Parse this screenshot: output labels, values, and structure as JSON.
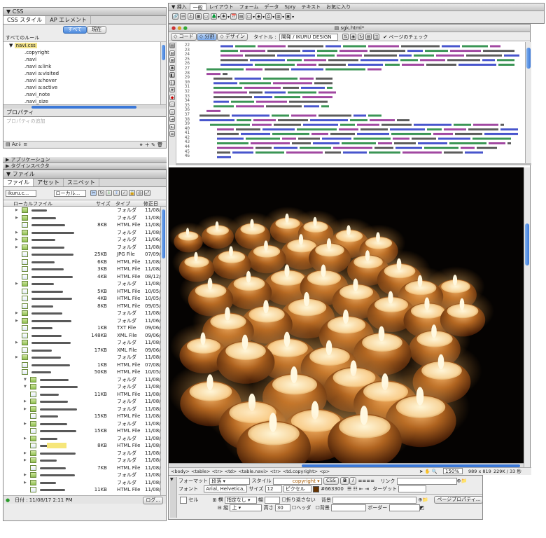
{
  "css_panel": {
    "title": "CSS",
    "tabs": [
      "CSS スタイル",
      "AP エレメント"
    ],
    "mode_buttons": [
      "すべて",
      "現在"
    ],
    "rules_header": "すべてのルール",
    "stylesheet": "navi.css",
    "rules": [
      ".copyright",
      ".navi",
      ".navi a:link",
      ".navi a:visited",
      ".navi a:hover",
      ".navi a:active",
      ".navi_note",
      ".navi_size"
    ],
    "properties_header": "プロパティ",
    "add_property": "プロパティの追加"
  },
  "collapsed_panels": [
    "アプリケーション",
    "タグインスペクタ"
  ],
  "files_panel": {
    "title": "ファイル",
    "tabs": [
      "ファイル",
      "アセット",
      "スニペット"
    ],
    "site": "ikuru.c...",
    "view": "ローカル...",
    "columns": [
      "ローカルファイル",
      "サイズ",
      "タイプ",
      "修正日"
    ],
    "rows": [
      {
        "size": "",
        "type": "フォルダ",
        "date": "11/08/16"
      },
      {
        "size": "",
        "type": "フォルダ",
        "date": "11/08/16"
      },
      {
        "size": "8KB",
        "type": "HTML File",
        "date": "11/08/16"
      },
      {
        "size": "",
        "type": "フォルダ",
        "date": "11/08/16"
      },
      {
        "size": "",
        "type": "フォルダ",
        "date": "11/06/08"
      },
      {
        "size": "",
        "type": "フォルダ",
        "date": "11/08/16"
      },
      {
        "size": "25KB",
        "type": "JPG File",
        "date": "07/09/12"
      },
      {
        "size": "6KB",
        "type": "HTML File",
        "date": "11/08/16"
      },
      {
        "size": "3KB",
        "type": "HTML File",
        "date": "11/08/17"
      },
      {
        "size": "4KB",
        "type": "HTML File",
        "date": "08/12/07"
      },
      {
        "size": "",
        "type": "フォルダ",
        "date": "11/08/17"
      },
      {
        "size": "5KB",
        "type": "HTML File",
        "date": "10/05/07"
      },
      {
        "size": "4KB",
        "type": "HTML File",
        "date": "10/05/07"
      },
      {
        "size": "8KB",
        "type": "HTML File",
        "date": "09/05/30"
      },
      {
        "size": "",
        "type": "フォルダ",
        "date": "11/08/16"
      },
      {
        "size": "",
        "type": "フォルダ",
        "date": "11/06/08"
      },
      {
        "size": "1KB",
        "type": "TXT File",
        "date": "09/06/11"
      },
      {
        "size": "148KB",
        "type": "XML File",
        "date": "09/06/11"
      },
      {
        "size": "",
        "type": "フォルダ",
        "date": "11/08/16"
      },
      {
        "size": "17KB",
        "type": "XML File",
        "date": "09/06/04"
      },
      {
        "size": "",
        "type": "フォルダ",
        "date": "11/08/17"
      },
      {
        "size": "1KB",
        "type": "HTML File",
        "date": "07/08/01"
      },
      {
        "size": "50KB",
        "type": "HTML File",
        "date": "10/05/15"
      },
      {
        "size": "",
        "type": "フォルダ",
        "date": "11/08/17"
      },
      {
        "size": "",
        "type": "フォルダ",
        "date": "11/08/17"
      },
      {
        "size": "11KB",
        "type": "HTML File",
        "date": "11/08/17"
      },
      {
        "size": "",
        "type": "フォルダ",
        "date": "11/08/17"
      },
      {
        "size": "",
        "type": "フォルダ",
        "date": "11/08/17"
      },
      {
        "size": "15KB",
        "type": "HTML File",
        "date": "11/08/17"
      },
      {
        "size": "",
        "type": "フォルダ",
        "date": "11/08/17"
      },
      {
        "size": "15KB",
        "type": "HTML File",
        "date": "11/08/17"
      },
      {
        "size": "",
        "type": "フォルダ",
        "date": "11/08/17"
      },
      {
        "size": "8KB",
        "type": "HTML File",
        "date": "11/08/17"
      },
      {
        "size": "",
        "type": "フォルダ",
        "date": "11/08/17"
      },
      {
        "size": "",
        "type": "フォルダ",
        "date": "11/08/17"
      },
      {
        "size": "7KB",
        "type": "HTML File",
        "date": "11/08/17"
      },
      {
        "size": "",
        "type": "フォルダ",
        "date": "11/08/17"
      },
      {
        "size": "",
        "type": "フォルダ",
        "date": "11/08/17"
      },
      {
        "size": "11KB",
        "type": "HTML File",
        "date": "11/08/17"
      }
    ],
    "status": "日付 : 11/08/17 2:11 PM",
    "log_button": "ログ..."
  },
  "insert_bar": {
    "title": "挿入",
    "tabs": [
      "一般",
      "レイアウト",
      "フォーム",
      "データ",
      "Spry",
      "テキスト",
      "お気に入り"
    ]
  },
  "document": {
    "filename": "sgk.html*",
    "view_buttons": [
      "コード",
      "分割",
      "デザイン"
    ],
    "title_label": "タイトル :",
    "title_value": "開発 / IKURU DESIGN",
    "check_page": "ページのチェック",
    "line_numbers": [
      "22",
      "23",
      "24",
      "25",
      "26",
      "27",
      "28",
      "29",
      "30",
      "31",
      "32",
      "33",
      "34",
      "35",
      "36",
      "37",
      "38",
      "39",
      "40",
      "41",
      "42",
      "43",
      "44",
      "45",
      "46"
    ],
    "tag_selector": "<body> <table> <tr> <td> <table.navi> <tr> <td.copyright> <p>",
    "zoom": "150%",
    "dimensions": "989 x 819",
    "size_time": "229K / 33 秒"
  },
  "properties": {
    "format_label": "フォーマット",
    "format_value": "段落",
    "style_label": "スタイル",
    "style_value": "copyright",
    "css_button": "CSS",
    "bold": "B",
    "italic": "I",
    "link_label": "リンク",
    "font_label": "フォント",
    "font_value": "Arial, Helvetica, s",
    "size_label": "サイズ",
    "size_value": "12",
    "unit_value": "ピクセル",
    "color_value": "#663300",
    "color_hex": "#663300",
    "target_label": "ターゲット",
    "cell_label": "セル",
    "horz_label": "横",
    "horz_value": "指定なし",
    "width_label": "幅",
    "nowrap_label": "折り返さない",
    "bg_label": "背景",
    "vert_label": "縦",
    "vert_value": "上",
    "height_label": "高さ",
    "height_value": "30",
    "header_label": "ヘッダ",
    "border_label": "ボーダー",
    "page_props": "ページプロパティ..."
  },
  "colors": {
    "accent": "#3b78d8",
    "code_blue": "#1a2bbf",
    "code_green": "#0a7a2a",
    "code_purple": "#8a1a8a",
    "candle_bg": "#050302"
  }
}
